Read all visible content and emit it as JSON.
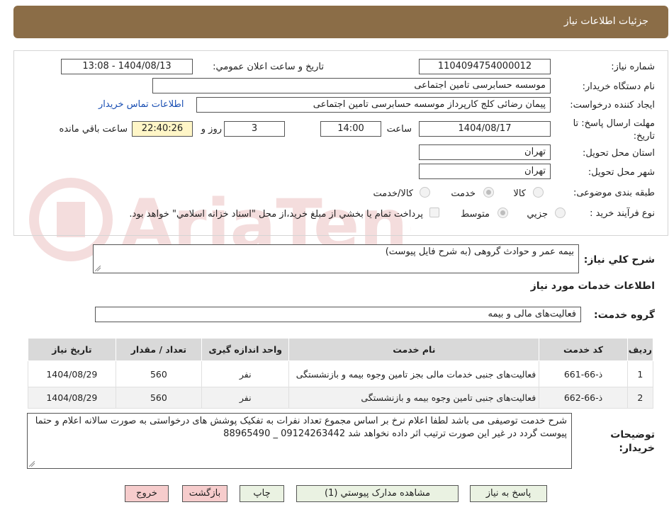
{
  "header": {
    "title": "جزئيات اطلاعات نياز"
  },
  "form": {
    "need_number_label": "شماره نياز:",
    "need_number": "1104094754000012",
    "announce_label": "تاريخ و ساعت اعلان عمومي:",
    "announce_value": "1404/08/13 - 13:08",
    "buyer_org_label": "نام دستگاه خريدار:",
    "buyer_org": "موسسه حسابرسی تامین اجتماعی",
    "creator_label": "ايجاد کننده درخواست:",
    "creator": "پیمان رضائی کلج کارپرداز موسسه حسابرسی تامین اجتماعی",
    "contact_link": "اطلاعات تماس خريدار",
    "deadline_label": "مهلت ارسال پاسخ: تا تاريخ:",
    "deadline_date": "1404/08/17",
    "time_label": "ساعت",
    "deadline_time": "14:00",
    "days_value": "3",
    "days_label": "روز و",
    "remaining_time": "22:40:26",
    "remaining_label": "ساعت باقي مانده",
    "province_label": "استان محل تحويل:",
    "province": "تهران",
    "city_label": "شهر محل تحويل:",
    "city": "تهران",
    "category_label": "طبقه بندی موضوعی:",
    "category_options": [
      "کالا",
      "خدمت",
      "کالا/خدمت"
    ],
    "category_selected": "خدمت",
    "process_label": "نوع فرآيند خريد :",
    "process_options": [
      "جزيي",
      "متوسط"
    ],
    "process_selected": "متوسط",
    "payment_note": "پرداخت تمام يا بخشي از مبلغ خريد،از محل \"اسناد خزانه اسلامي\" خواهد بود."
  },
  "summary": {
    "label": "شرح کلي نياز:",
    "value": "بیمه عمر و حوادث گروهی (به شرح فایل پیوست)"
  },
  "services_section": {
    "title": "اطلاعات خدمات مورد نياز",
    "group_label": "گروه خدمت:",
    "group_value": "فعالیت‌های مالی و بیمه"
  },
  "table": {
    "headers": [
      "رديف",
      "کد خدمت",
      "نام خدمت",
      "واحد اندازه گيری",
      "تعداد / مقدار",
      "تاريخ نياز"
    ],
    "rows": [
      {
        "row": "1",
        "code": "ذ-66-661",
        "name": "فعالیت‌های جنبی خدمات مالی بجز تامین وجوه بیمه و بازنشستگی",
        "unit": "نفر",
        "qty": "560",
        "date": "1404/08/29"
      },
      {
        "row": "2",
        "code": "ذ-66-662",
        "name": "فعالیت‌های جنبی تامین وجوه بیمه و بازنشستگی",
        "unit": "نفر",
        "qty": "560",
        "date": "1404/08/29"
      }
    ]
  },
  "buyer_notes": {
    "label": "توضيحات خريدار:",
    "value": "شرح خدمت توصیفی می باشد لطفا اعلام نرخ بر اساس مجموع تعداد نفرات به تفکیک پوشش های درخواستی به صورت سالانه اعلام و حتما پیوست گردد در غیر این صورت ترتیب اثر داده نخواهد شد 09124263442 _ 88965490"
  },
  "buttons": {
    "respond": "پاسخ به نياز",
    "attachments": "مشاهده مدارک پيوستي (1)",
    "print": "چاپ",
    "back": "بازگشت",
    "exit": "خروج"
  },
  "watermark": {
    "text": "AriaTender.neT"
  }
}
